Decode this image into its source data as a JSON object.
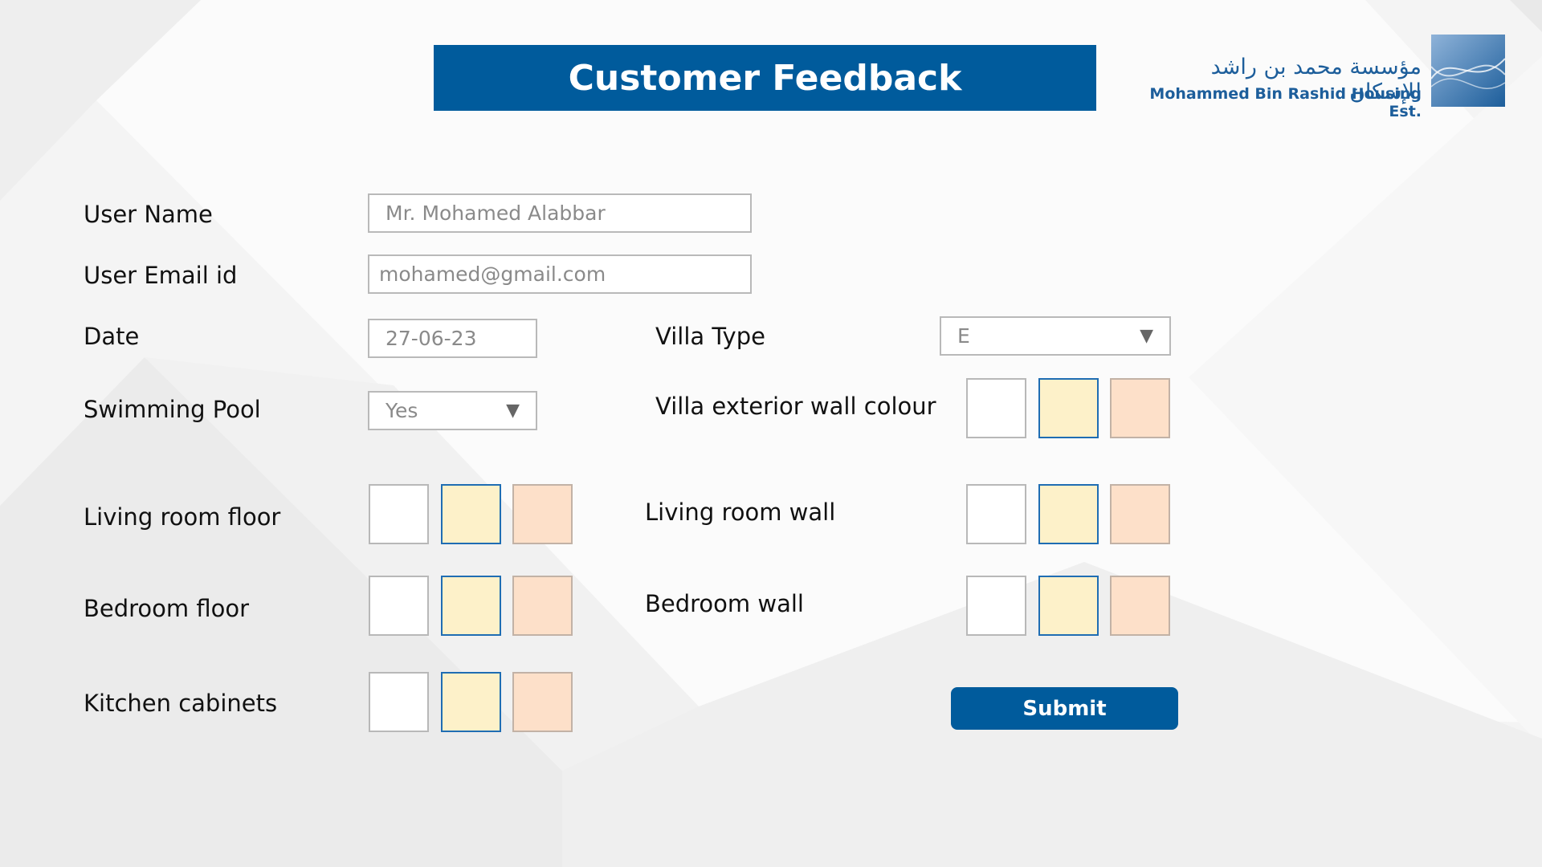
{
  "header": {
    "title": "Customer Feedback",
    "logo_arabic": "مؤسسة محمد بن راشد للإسكان",
    "logo_english": "Mohammed Bin Rashid Housing Est."
  },
  "form": {
    "user_name": {
      "label": "User Name",
      "value": "Mr. Mohamed Alabbar"
    },
    "user_email": {
      "label": "User Email id",
      "value": "mohamed@gmail.com"
    },
    "date": {
      "label": "Date",
      "value": "27-06-23"
    },
    "swimming_pool": {
      "label": "Swimming Pool",
      "value": "Yes"
    },
    "villa_type": {
      "label": "Villa Type",
      "value": "E"
    },
    "villa_exterior_wall": {
      "label": "Villa exterior wall colour"
    },
    "living_room_floor": {
      "label": "Living room floor"
    },
    "living_room_wall": {
      "label": "Living room wall"
    },
    "bedroom_floor": {
      "label": "Bedroom floor"
    },
    "bedroom_wall": {
      "label": "Bedroom wall"
    },
    "kitchen_cabinets": {
      "label": "Kitchen cabinets"
    },
    "submit_label": "Submit"
  },
  "swatch_colors": [
    "#ffffff",
    "#fdf1c9",
    "#fde0c9"
  ],
  "colors": {
    "brand": "#005b9c",
    "selected_border": "#1f6db3"
  },
  "icons": {
    "select_caret": "triangle-down-icon"
  }
}
